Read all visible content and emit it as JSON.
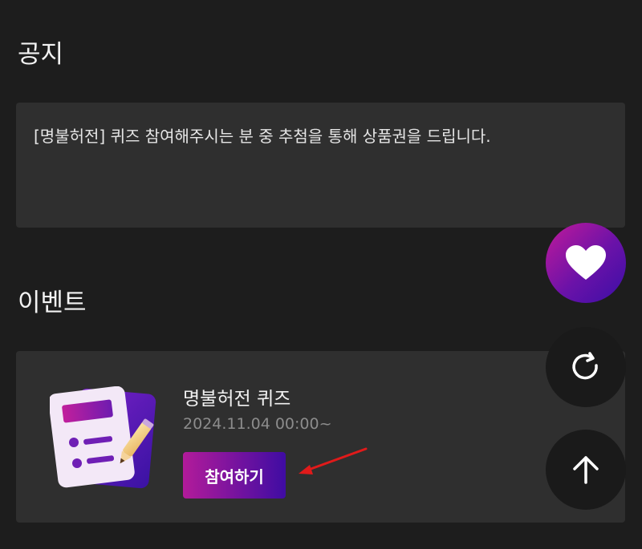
{
  "notice": {
    "title": "공지",
    "text": "[명불허전] 퀴즈 참여해주시는 분 중 추첨을 통해 상품권을 드립니다."
  },
  "events": {
    "title": "이벤트",
    "items": [
      {
        "name": "명불허전 퀴즈",
        "date": "2024.11.04 00:00~",
        "button_label": "참여하기",
        "icon": "quiz-note-icon"
      }
    ]
  },
  "floating_buttons": {
    "like_icon": "heart-icon",
    "refresh_icon": "refresh-icon",
    "scroll_top_icon": "arrow-up-icon"
  },
  "colors": {
    "background": "#1d1d1d",
    "card": "#2f2f2f",
    "accent_start": "#b21b9a",
    "accent_end": "#3f0ca3",
    "annotation": "#e01a1a"
  }
}
